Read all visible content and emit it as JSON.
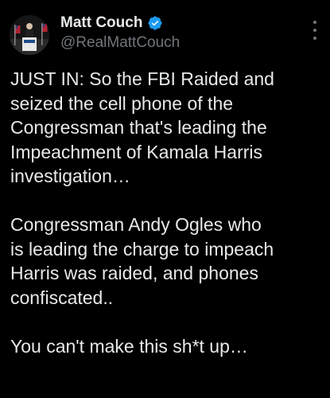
{
  "author": {
    "display_name": "Matt Couch",
    "handle": "@RealMattCouch",
    "verified": true,
    "verified_icon": "verified-badge-icon",
    "avatar_icon": "avatar-podium-speaker"
  },
  "menu": {
    "icon": "more-vertical-icon"
  },
  "tweet": {
    "paragraphs": [
      "JUST IN: So the FBI Raided and\nseized the cell phone of the\nCongressman that's leading the\nImpeachment of Kamala Harris\ninvestigation…",
      "Congressman Andy Ogles who\nis leading the charge to impeach\nHarris was raided, and phones\nconfiscated..",
      "You can't make this sh*t up…"
    ]
  },
  "colors": {
    "background": "#000000",
    "text_primary": "#e7e9ea",
    "text_secondary": "#71767b",
    "verified_blue": "#1d9bf0"
  }
}
